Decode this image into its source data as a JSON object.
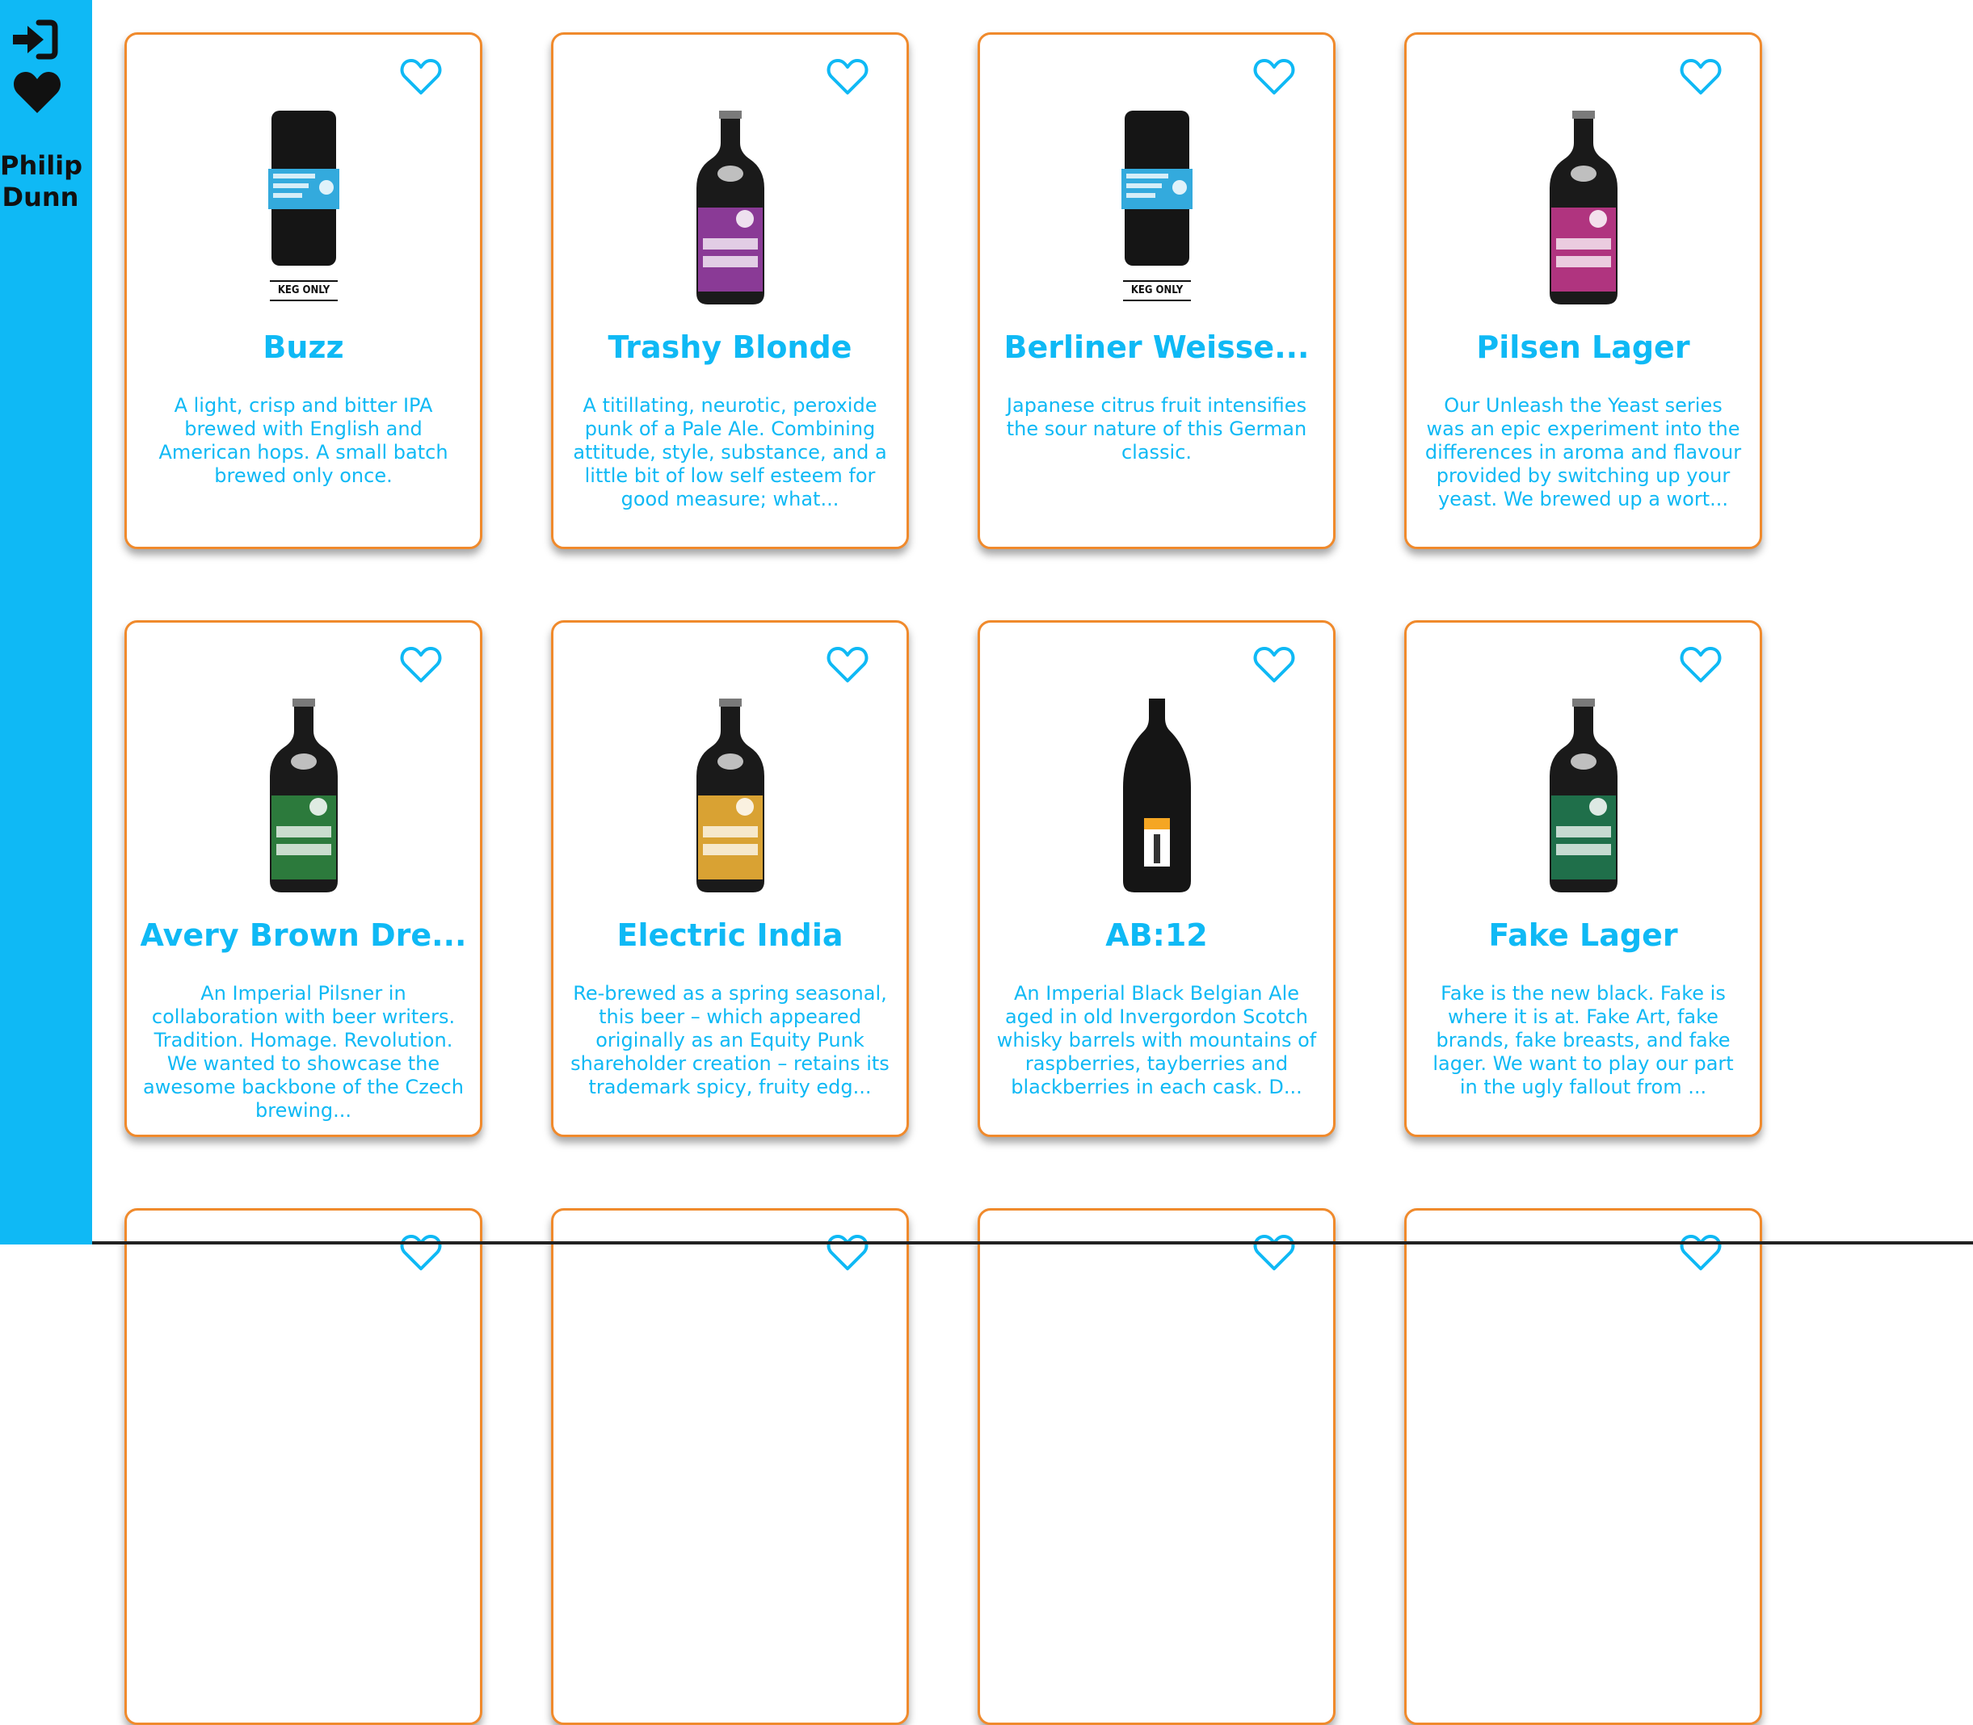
{
  "sidebar": {
    "user_name_first": "Philip",
    "user_name_last": "Dunn"
  },
  "colors": {
    "accent": "#0fb9f5",
    "card_border": "#f08a2c"
  },
  "beers": [
    {
      "name": "Buzz",
      "description": "A light, crisp and bitter IPA brewed with English and American hops. A small batch brewed only once.",
      "bottle": "keg",
      "label_color": "#2aa7d8",
      "keg_label": "KEG ONLY"
    },
    {
      "name": "Trashy Blonde",
      "description": "A titillating, neurotic, peroxide punk of a Pale Ale. Combining attitude, style, substance, and a little bit of low self esteem for good measure; what...",
      "bottle": "bottle",
      "label_color": "#8a3a96"
    },
    {
      "name": "Berliner Weisse...",
      "description": "Japanese citrus fruit intensifies the sour nature of this German classic.",
      "bottle": "keg",
      "label_color": "#2aa7d8",
      "keg_label": "KEG ONLY"
    },
    {
      "name": "Pilsen Lager",
      "description": "Our Unleash the Yeast series was an epic experiment into the differences in aroma and flavour provided by switching up your yeast. We brewed up a wort...",
      "bottle": "bottle",
      "label_color": "#b0347f"
    },
    {
      "name": "Avery Brown Dre...",
      "description": "An Imperial Pilsner in collaboration with beer writers. Tradition. Homage. Revolution. We wanted to showcase the awesome backbone of the Czech brewing...",
      "bottle": "bottle",
      "label_color": "#2c7a3c"
    },
    {
      "name": "Electric India",
      "description": "Re-brewed as a spring seasonal, this beer – which appeared originally as an Equity Punk shareholder creation – retains its trademark spicy, fruity edg...",
      "bottle": "bottle",
      "label_color": "#d9a233"
    },
    {
      "name": "AB:12",
      "description": "An Imperial Black Belgian Ale aged in old Invergordon Scotch whisky barrels with mountains of raspberries, tayberries and blackberries in each cask. D...",
      "bottle": "champagne",
      "label_color": "#f5a623"
    },
    {
      "name": "Fake Lager",
      "description": "Fake is the new black. Fake is where it is at. Fake Art, fake brands, fake breasts, and fake lager. We want to play our part in the ugly fallout from ...",
      "bottle": "bottle",
      "label_color": "#1f6f4a"
    },
    {
      "name": "",
      "description": "",
      "bottle": "none"
    },
    {
      "name": "",
      "description": "",
      "bottle": "none"
    },
    {
      "name": "",
      "description": "",
      "bottle": "none"
    },
    {
      "name": "",
      "description": "",
      "bottle": "none"
    }
  ]
}
